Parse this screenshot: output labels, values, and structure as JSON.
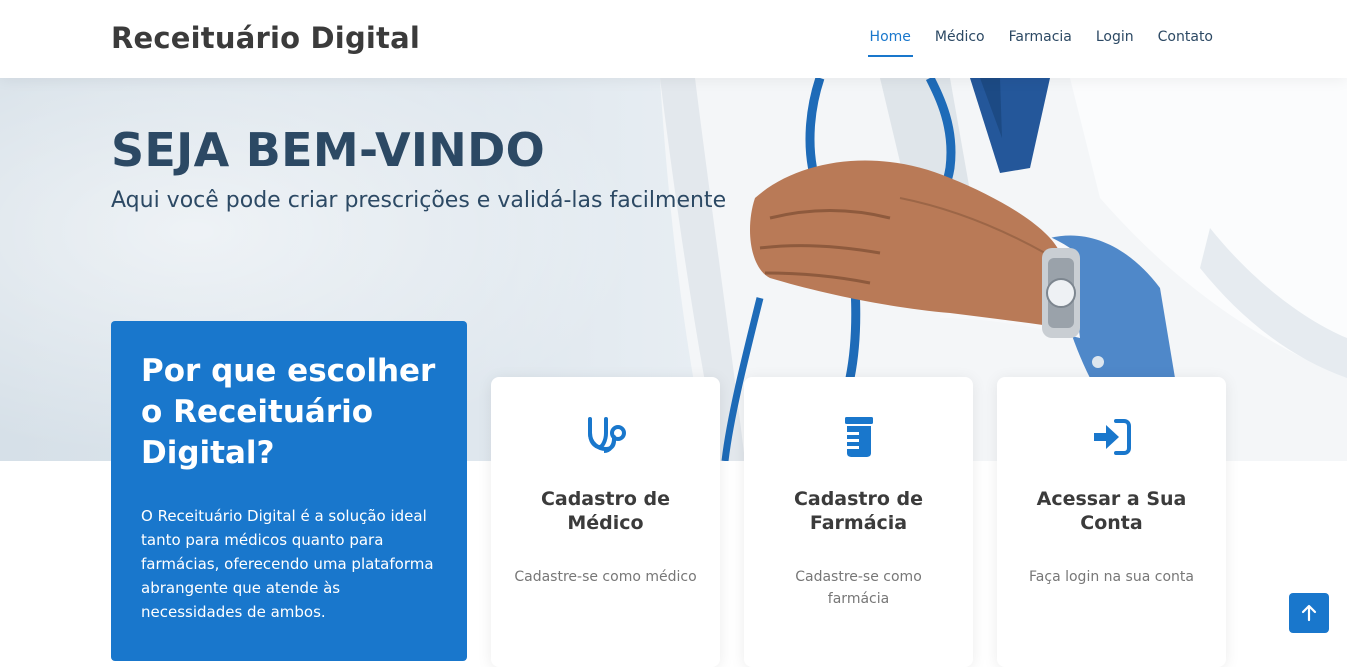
{
  "header": {
    "logo": "Receituário Digital",
    "nav": [
      {
        "label": "Home",
        "active": true
      },
      {
        "label": "Médico",
        "active": false
      },
      {
        "label": "Farmacia",
        "active": false
      },
      {
        "label": "Login",
        "active": false
      },
      {
        "label": "Contato",
        "active": false
      }
    ]
  },
  "hero": {
    "title": "SEJA BEM-VINDO",
    "subtitle": "Aqui você pode criar prescrições e validá-las facilmente"
  },
  "why": {
    "title": "Por que escolher o Receituário Digital?",
    "text": "O Receituário Digital é a solução ideal tanto para médicos quanto para farmácias, oferecendo uma plataforma abrangente que atende às necessidades de ambos."
  },
  "cards": [
    {
      "icon": "stethoscope-icon",
      "title": "Cadastro de Médico",
      "desc": "Cadastre-se como médico"
    },
    {
      "icon": "prescription-bottle-icon",
      "title": "Cadastro de Farmácia",
      "desc": "Cadastre-se como farmácia"
    },
    {
      "icon": "login-icon",
      "title": "Acessar a Sua Conta",
      "desc": "Faça login na sua conta"
    }
  ],
  "colors": {
    "accent": "#1977cc",
    "heading": "#2c4964",
    "text_dark": "#3b3b3b",
    "muted": "#777777"
  },
  "back_to_top": {
    "icon": "arrow-up-icon"
  }
}
